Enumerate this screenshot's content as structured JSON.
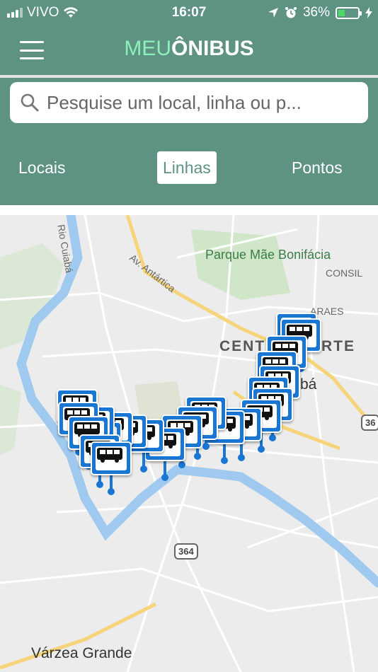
{
  "status_bar": {
    "carrier": "VIVO",
    "time": "16:07",
    "battery": "36%",
    "battery_level": 0.36,
    "icons": [
      "signal-icon",
      "wifi-icon",
      "location-arrow-icon",
      "alarm-icon",
      "battery-icon",
      "charging-icon"
    ]
  },
  "app_bar": {
    "logo_part1": "MEU",
    "logo_part2": "ÔNIBUS",
    "menu_icon": "hamburger-menu-icon"
  },
  "search": {
    "placeholder": "Pesquise um local, linha ou p...",
    "icon": "search-icon"
  },
  "tabs": [
    {
      "label": "Locais",
      "active": false
    },
    {
      "label": "Linhas",
      "active": true
    },
    {
      "label": "Pontos",
      "active": false
    }
  ],
  "map": {
    "labels": {
      "river": "Rio Cuiabá",
      "avenue": "Av. Antártica",
      "park": "Parque Mãe Bonifácia",
      "consil": "CONSIL",
      "araes": "ARAES",
      "centro": "CENTRO NORTE",
      "cuiaba_partial": "bá",
      "city": "Várzea Grande",
      "highway_364": "364",
      "highway_36": "36"
    },
    "colors": {
      "background": "#ececec",
      "water": "#9fc9ef",
      "major_road": "#f5d47a",
      "park": "#cfe6c9",
      "stop_marker": "#1976d2"
    },
    "marker_icon": "bus-stop-icon",
    "marker_count": 24
  }
}
